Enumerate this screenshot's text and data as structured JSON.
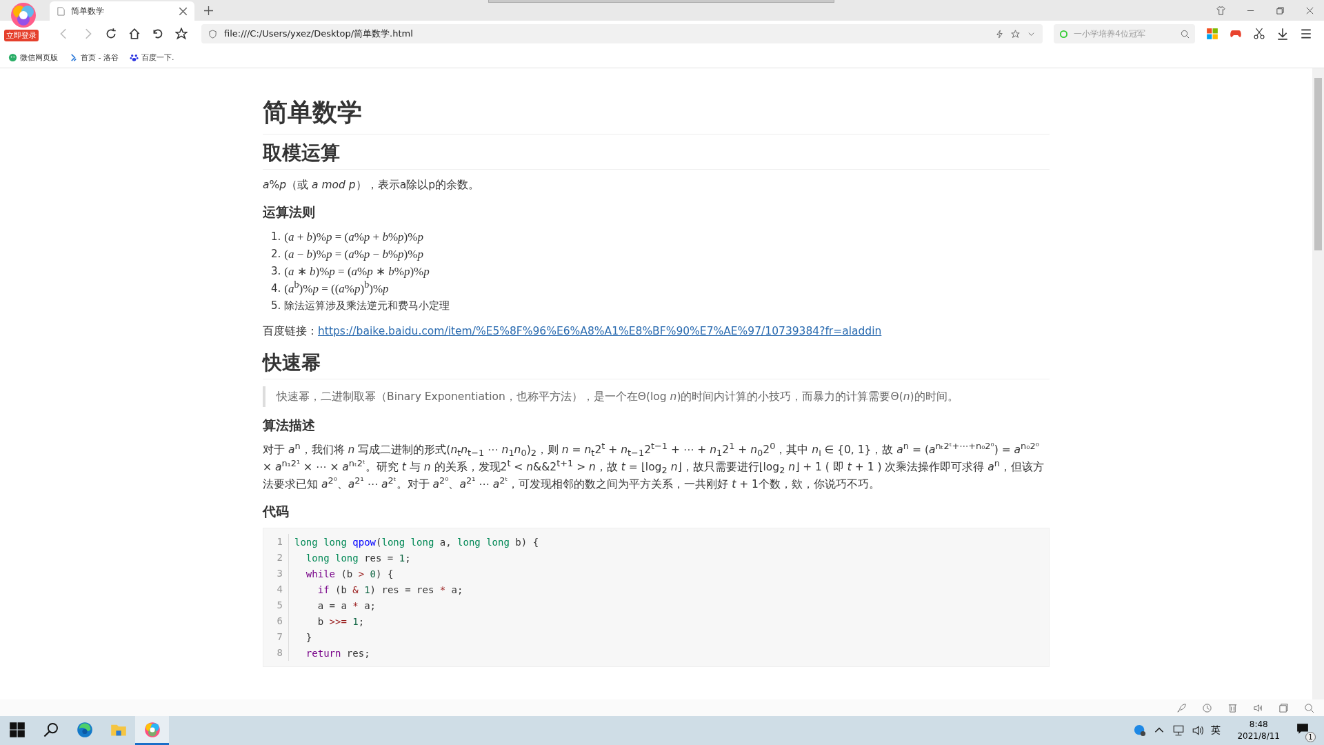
{
  "browser": {
    "login_badge": "立即登录",
    "tabs": [
      {
        "title": "简单数学",
        "selected": true
      }
    ],
    "address": "file:///C:/Users/yxez/Desktop/简单数学.html",
    "search_placeholder": "一小学培养4位冠军",
    "bookmarks": [
      {
        "label": "微信网页版",
        "kind": "wechat"
      },
      {
        "label": "首页 - 洛谷",
        "kind": "luogu"
      },
      {
        "label": "百度一下.",
        "kind": "baidu"
      }
    ]
  },
  "content": [
    {
      "kind": "h1",
      "text": "简单数学"
    },
    {
      "kind": "h2",
      "text": "取模运算"
    },
    {
      "kind": "p",
      "text": "*a*%*p*（或 *a*  *mod*  *p*），表示a除以p的余数。"
    },
    {
      "kind": "h3",
      "text": "运算法则"
    },
    {
      "kind": "ol",
      "items": [
        {
          "number": "1.",
          "text": "(*a* + *b*)%*p* = (*a*%*p* + *b*%*p*)%*p*"
        },
        {
          "number": "2.",
          "text": "(*a* − *b*)%*p* = (*a*%*p* − *b*%*p*)%*p*"
        },
        {
          "number": "3.",
          "text": "(*a* ∗ *b*)%*p* = (*a*%*p* ∗ *b*%*p*)%*p*"
        },
        {
          "number": "4.",
          "text": "(*a*$^{b}$)%*p* = ((*a*%*p*)$^{b}$)%*p*"
        },
        {
          "number": "5.",
          "text": "除法运算涉及乘法逆元和费马小定理"
        }
      ]
    },
    {
      "kind": "link",
      "label": "百度链接：",
      "url": "https://baike.baidu.com/item/%E5%8F%96%E6%A8%A1%E8%BF%90%E7%AE%97/10739384?fr=aladdin"
    },
    {
      "kind": "h2",
      "text": "快速幂"
    },
    {
      "kind": "quote",
      "text": "快速幂，二进制取幂（Binary Exponentiation，也称平方法），是一个在Θ(log *n*)的时间内计算的小技巧，而暴力的计算需要Θ(*n*)的时间。"
    },
    {
      "kind": "h3",
      "text": "算法描述"
    },
    {
      "kind": "p",
      "text": "对于 *a*$^{n}$，我们将 *n* 写成二进制的形式(*n*$_{t}$*n*$_{t−1}$ ⋯ *n*$_{1}$*n*$_{0}$)$_{2}$，则 *n* = *n*$_{t}$2$^{t}$ + *n*$_{t−1}$2$^{t−1}$ + ⋯ + *n*$_{1}$2$^{1}$ + *n*$_{0}$2$^{0}$，其中 *n*$_{i}$ ∈ {0, 1}，故 *a*$^{n}$ = (*a*$^{nₜ2ᵗ+⋯+n₀2⁰}$) = *a*$^{n₀2⁰}$ × *a*$^{n₁2¹}$ × ⋯ × *a*$^{nₜ2ᵗ}$。研究 *t* 与 *n* 的关系，发现2$^{t}$ < *n*&&2$^{t+1}$ > *n*，故 *t* = ⌊log$_{2}$ *n*⌋，故只需要进行⌊log$_{2}$ *n*⌋ + 1 ( 即 *t* + 1 ) 次乘法操作即可求得 *a*$^{n}$，但该方法要求已知 *a*$^{2⁰}$、*a*$^{2¹}$ ⋯ *a*$^{2ᵗ}$。对于 *a*$^{2⁰}$、*a*$^{2¹}$ ⋯ *a*$^{2ᵗ}$，可发现相邻的数之间为平方关系，一共刚好 *t* + 1个数，欸，你说巧不巧。"
    },
    {
      "kind": "h3",
      "text": "代码"
    },
    {
      "kind": "code",
      "lines": [
        {
          "number": "1",
          "tokens": [
            {
              "kind": "type",
              "s": "long long "
            },
            {
              "kind": "def",
              "s": "qpow"
            },
            {
              "kind": "plain",
              "s": "("
            },
            {
              "kind": "type",
              "s": "long long "
            },
            {
              "kind": "plain",
              "s": "a, "
            },
            {
              "kind": "type",
              "s": "long long "
            },
            {
              "kind": "plain",
              "s": "b) {"
            }
          ]
        },
        {
          "number": "2",
          "tokens": [
            {
              "kind": "type",
              "s": "  long long "
            },
            {
              "kind": "plain",
              "s": "res = "
            },
            {
              "kind": "num",
              "s": "1"
            },
            {
              "kind": "plain",
              "s": ";"
            }
          ]
        },
        {
          "number": "3",
          "tokens": [
            {
              "kind": "kw",
              "s": "  while"
            },
            {
              "kind": "plain",
              "s": " (b "
            },
            {
              "kind": "op",
              "s": "> "
            },
            {
              "kind": "num",
              "s": "0"
            },
            {
              "kind": "plain",
              "s": ") {"
            }
          ]
        },
        {
          "number": "4",
          "tokens": [
            {
              "kind": "kw",
              "s": "    if"
            },
            {
              "kind": "plain",
              "s": " (b "
            },
            {
              "kind": "op",
              "s": "& "
            },
            {
              "kind": "num",
              "s": "1"
            },
            {
              "kind": "plain",
              "s": ") res = res "
            },
            {
              "kind": "op",
              "s": "*"
            },
            {
              "kind": "plain",
              "s": " a;"
            }
          ]
        },
        {
          "number": "5",
          "tokens": [
            {
              "kind": "plain",
              "s": "    a = a "
            },
            {
              "kind": "op",
              "s": "*"
            },
            {
              "kind": "plain",
              "s": " a;"
            }
          ]
        },
        {
          "number": "6",
          "tokens": [
            {
              "kind": "plain",
              "s": "    b "
            },
            {
              "kind": "op",
              "s": ">>= "
            },
            {
              "kind": "num",
              "s": "1"
            },
            {
              "kind": "plain",
              "s": ";"
            }
          ]
        },
        {
          "number": "7",
          "tokens": [
            {
              "kind": "plain",
              "s": "  }"
            }
          ]
        },
        {
          "number": "8",
          "tokens": [
            {
              "kind": "kw",
              "s": "  return"
            },
            {
              "kind": "plain",
              "s": " res;"
            }
          ]
        }
      ]
    }
  ],
  "taskbar": {
    "apps": [
      {
        "kind": "start",
        "selected": false
      },
      {
        "kind": "search",
        "selected": false
      },
      {
        "kind": "edge",
        "selected": false
      },
      {
        "kind": "files",
        "selected": false
      },
      {
        "kind": "browser",
        "selected": true
      }
    ],
    "ime": "英",
    "time": "8:48",
    "date": "2021/8/11",
    "notifications": "1"
  }
}
